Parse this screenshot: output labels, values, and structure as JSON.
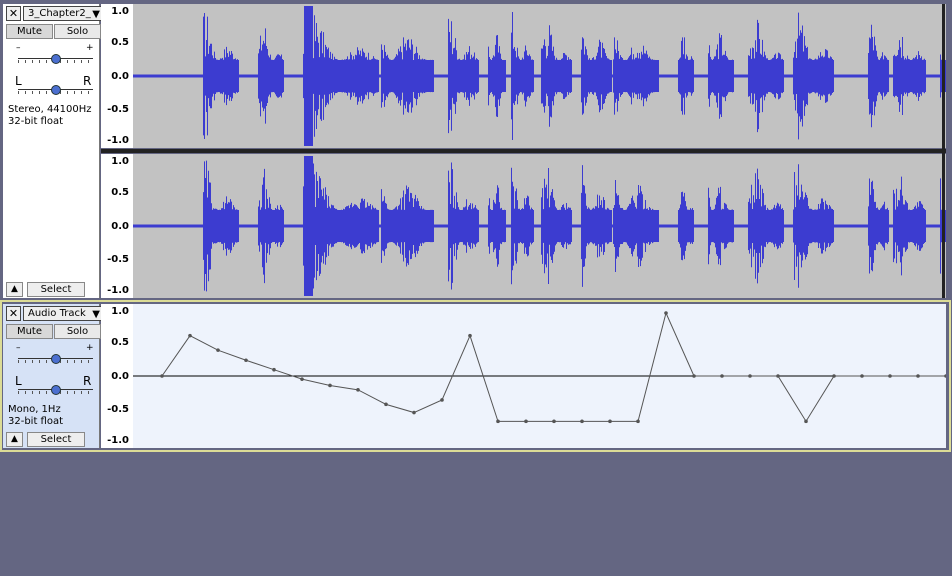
{
  "tracks": [
    {
      "name": "3_Chapter2_",
      "mute_label": "Mute",
      "solo_label": "Solo",
      "gain_minus": "–",
      "gain_plus": "+",
      "pan_left": "L",
      "pan_right": "R",
      "format_line1": "Stereo, 44100Hz",
      "format_line2": "32-bit float",
      "select_label": "Select",
      "ruler_ticks": [
        "1.0",
        "0.5",
        "0.0",
        "-0.5",
        "-1.0"
      ]
    },
    {
      "name": "Audio Track",
      "mute_label": "Mute",
      "solo_label": "Solo",
      "gain_minus": "–",
      "gain_plus": "+",
      "pan_left": "L",
      "pan_right": "R",
      "format_line1": "Mono, 1Hz",
      "format_line2": "32-bit float",
      "select_label": "Select",
      "ruler_ticks": [
        "1.0",
        "0.5",
        "0.0",
        "-0.5",
        "-1.0"
      ],
      "samples": [
        0.0,
        0.64,
        0.41,
        0.25,
        0.1,
        -0.05,
        -0.15,
        -0.22,
        -0.45,
        -0.58,
        -0.38,
        0.64,
        -0.72,
        -0.72,
        -0.72,
        -0.72,
        -0.72,
        -0.72,
        1.0,
        0.0,
        0.0,
        0.0,
        0.0,
        -0.72,
        0.0,
        0.0,
        0.0,
        0.0,
        0.0
      ]
    }
  ],
  "colors": {
    "background": "#646682",
    "waveform": "#3c3cd0",
    "waveform_bg": "#c2c2c2",
    "envelope_bg": "#eef3fc",
    "selected_border": "#dcdc96"
  },
  "icons": {
    "close": "close-icon",
    "dropdown": "chevron-down-icon",
    "collapse": "collapse-up-icon"
  }
}
